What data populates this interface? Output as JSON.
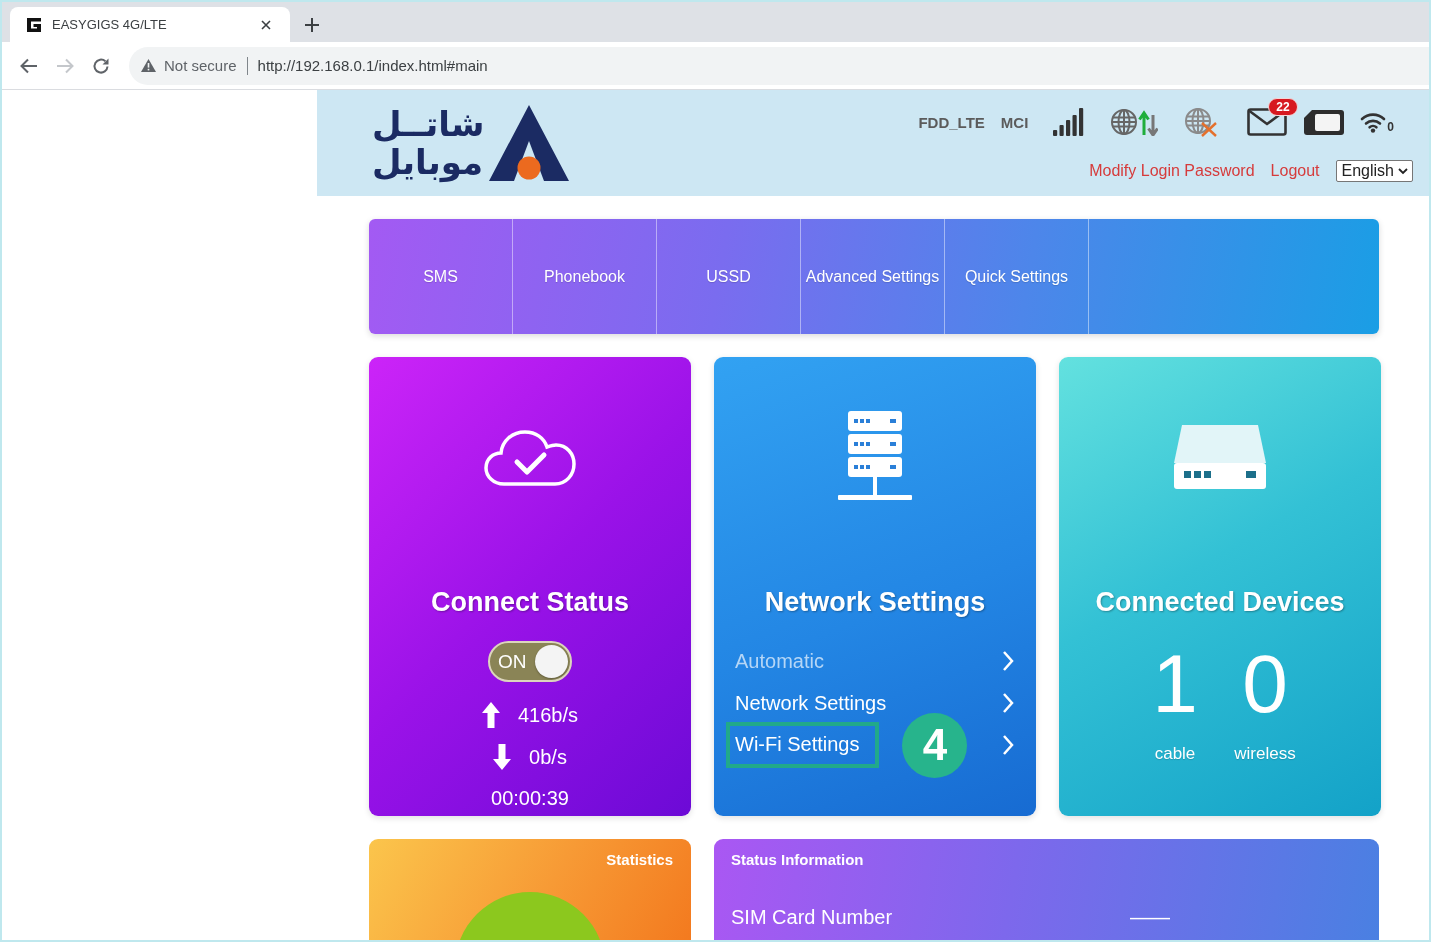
{
  "browser": {
    "tab": {
      "title": "EASYGIGS 4G/LTE"
    },
    "nav_buttons": [
      {
        "kind": "back",
        "disabled": false
      },
      {
        "kind": "forward",
        "disabled": true
      },
      {
        "kind": "reload",
        "disabled": false
      }
    ],
    "address_bar": {
      "security": "Not secure",
      "url": "http://192.168.0.1/index.html#main"
    }
  },
  "header": {
    "logo": {
      "line_1": "شاتــل",
      "line_2": "موبایل"
    },
    "status": {
      "network_type": "FDD_LTE",
      "operator": "MCI",
      "unread_messages": "22",
      "wifi_clients": "0"
    },
    "links": [
      "Modify Login Password",
      "Logout"
    ],
    "language": {
      "value": "English"
    }
  },
  "menu": {
    "items": [
      "SMS",
      "Phonebook",
      "USSD",
      "Advanced Settings",
      "Quick Settings"
    ]
  },
  "connect_status": {
    "title": "Connect Status",
    "switch": {
      "label": "ON",
      "on": true
    },
    "upload": "416b/s",
    "download": "0b/s",
    "duration": "00:00:39"
  },
  "network_settings": {
    "title": "Network Settings",
    "items": [
      {
        "label": "Automatic",
        "disabled": true,
        "highlighted": false
      },
      {
        "label": "Network Settings",
        "disabled": false,
        "highlighted": false
      },
      {
        "label": "Wi-Fi Settings",
        "disabled": false,
        "highlighted": true,
        "step": "4"
      }
    ]
  },
  "connected_devices": {
    "title": "Connected Devices",
    "counts": [
      {
        "value": "1",
        "label": "cable"
      },
      {
        "value": "0",
        "label": "wireless"
      }
    ]
  },
  "statistics": {
    "title": "Statistics"
  },
  "status_information": {
    "title": "Status Information",
    "rows": [
      {
        "label": "SIM Card Number",
        "value": "——"
      }
    ]
  }
}
